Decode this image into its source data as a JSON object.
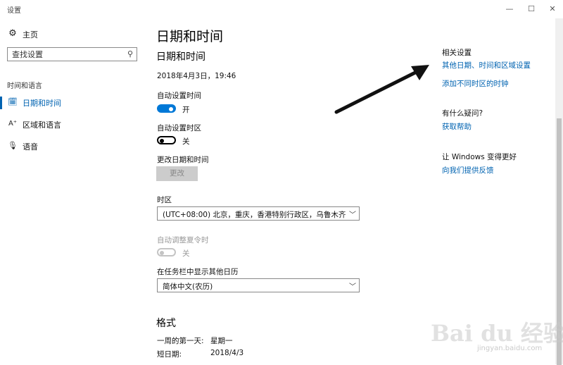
{
  "window": {
    "title": "设置",
    "minimize_glyph": "—",
    "maximize_glyph": "☐",
    "close_glyph": "✕"
  },
  "sidebar": {
    "home": {
      "label": "主页",
      "icon": "gear-icon",
      "glyph": "⚙"
    },
    "search": {
      "placeholder": "查找设置",
      "icon": "search-icon",
      "glyph": "⚲"
    },
    "section_label": "时间和语言",
    "items": [
      {
        "label": "日期和时间",
        "icon": "calendar-clock-icon",
        "glyph": "🗓",
        "active": true
      },
      {
        "label": "区域和语言",
        "icon": "language-icon",
        "glyph": "A⁺"
      },
      {
        "label": "语音",
        "icon": "microphone-icon",
        "glyph": "🎙"
      }
    ]
  },
  "main": {
    "page_title": "日期和时间",
    "section_title": "日期和时间",
    "current_datetime": "2018年4月3日，19:46",
    "auto_time": {
      "label": "自动设置时间",
      "state_text": "开",
      "on": true
    },
    "auto_timezone": {
      "label": "自动设置时区",
      "state_text": "关",
      "on": false
    },
    "change_datetime": {
      "label": "更改日期和时间",
      "button_label": "更改"
    },
    "timezone": {
      "label": "时区",
      "value": "(UTC+08:00) 北京，重庆，香港特别行政区，乌鲁木齐"
    },
    "dst": {
      "label": "自动调整夏令时",
      "state_text": "关",
      "disabled": true
    },
    "taskbar_calendar": {
      "label": "在任务栏中显示其他日历",
      "value": "简体中文(农历)"
    },
    "format": {
      "title": "格式",
      "rows": [
        {
          "key": "一周的第一天:",
          "value": "星期一"
        },
        {
          "key": "短日期:",
          "value": "2018/4/3"
        }
      ]
    }
  },
  "related": {
    "title": "相关设置",
    "links": [
      "其他日期、时间和区域设置",
      "添加不同时区的时钟"
    ],
    "help_title": "有什么疑问?",
    "help_link": "获取帮助",
    "feedback_title": "让 Windows 变得更好",
    "feedback_link": "向我们提供反馈"
  },
  "watermark": {
    "text": "Bai du 经验",
    "sub": "jingyan.baidu.com"
  },
  "colors": {
    "accent": "#0063b1",
    "toggle_on": "#0078d7",
    "arrow": "#111111"
  }
}
